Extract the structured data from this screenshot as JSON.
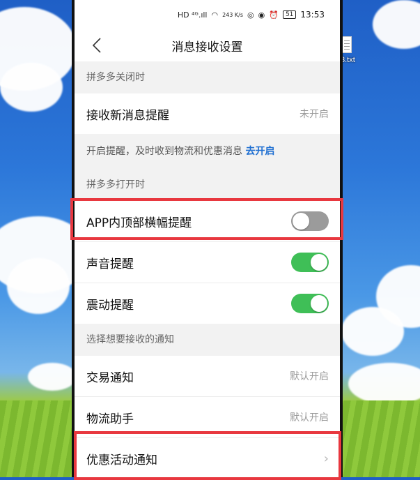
{
  "statusbar": {
    "signal_text": "HD ⁴ᴳ.ıll",
    "speed": "243 K/s",
    "battery": "51",
    "time": "13:53"
  },
  "desktop": {
    "file_label": "3.txt"
  },
  "navbar": {
    "title": "消息接收设置"
  },
  "sections": {
    "closed": {
      "header": "拼多多关闭时",
      "new_message": {
        "label": "接收新消息提醒",
        "value": "未开启"
      },
      "hint": "开启提醒，及时收到物流和优惠消息 ",
      "hint_link": "去开启"
    },
    "open": {
      "header": "拼多多打开时",
      "banner": {
        "label": "APP内顶部横幅提醒",
        "enabled": false
      },
      "sound": {
        "label": "声音提醒",
        "enabled": true
      },
      "vibrate": {
        "label": "震动提醒",
        "enabled": true
      }
    },
    "notifications": {
      "header": "选择想要接收的通知",
      "trade": {
        "label": "交易通知",
        "value": "默认开启"
      },
      "logistics": {
        "label": "物流助手",
        "value": "默认开启"
      },
      "promo": {
        "label": "优惠活动通知",
        "chevron": "chevron-right-icon"
      }
    }
  },
  "colors": {
    "toggle_on": "#3fbf57",
    "toggle_off": "#9b9b9b",
    "link": "#1f6fd1",
    "highlight_box": "#e8383f"
  }
}
